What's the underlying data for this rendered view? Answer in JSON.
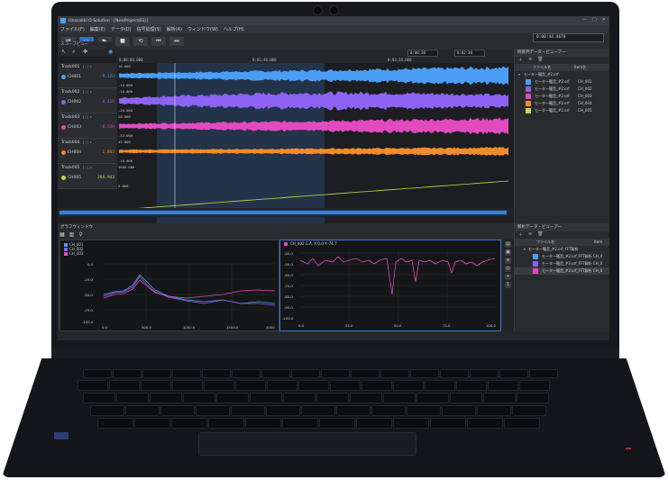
{
  "app": {
    "title": "Onosokki O-Solution - [NewProject(61)]",
    "menu": [
      "ファイル(F)",
      "編集(E)",
      "データ(D)",
      "信号処理(S)",
      "解析(A)",
      "ウィンドウ(W)",
      "ヘルプ(H)"
    ],
    "time_display": "0:00:44.4678"
  },
  "scope_panel": {
    "tab_label": "スコープビュー",
    "transport_start": "0:00:30",
    "transport_end": "0:02:30",
    "ruler_labels": [
      "0:00:00.000",
      "0:01:40.000",
      "0:03:20.000"
    ],
    "tracks": [
      {
        "name": "Track001",
        "channel": "CH001",
        "value": "-9.323",
        "color": "#4a9ef5",
        "scale_top": "16.000",
        "scale_bottom": "-16.000"
      },
      {
        "name": "Track002",
        "channel": "CH002",
        "value": "8.425",
        "color": "#8c63f2",
        "scale_top": "-18.000",
        "scale_bottom": "-20.000"
      },
      {
        "name": "Track003",
        "channel": "CH003",
        "value": "-8.539",
        "color": "#e24bc0",
        "scale_top": "20.000",
        "scale_bottom": "-32.000"
      },
      {
        "name": "Track004",
        "channel": "CH004",
        "value": "1.883",
        "color": "#f08c2a",
        "scale_top": "32.000",
        "scale_bottom": "-16.000"
      },
      {
        "name": "Track005",
        "channel": "CH005",
        "value": "284.943",
        "color": "#c7d94a",
        "scale_top": "3600.000",
        "scale_bottom": "0.000"
      }
    ]
  },
  "data_viewer": {
    "title": "時系列データ・ビューアー",
    "columns": [
      "ファイル名",
      "Item名"
    ],
    "group": "モーター騒音_#2.orf",
    "items": [
      {
        "file": "モーター騒音_#2.orf",
        "item": "CH_001",
        "color": "#4a9ef5"
      },
      {
        "file": "モーター騒音_#2.orf",
        "item": "CH_002",
        "color": "#8c63f2"
      },
      {
        "file": "モーター騒音_#2.orf",
        "item": "CH_003",
        "color": "#e24bc0"
      },
      {
        "file": "モーター騒音_#2.orf",
        "item": "CH_004",
        "color": "#f08c2a"
      },
      {
        "file": "モーター騒音_#2.orf",
        "item": "CH_005",
        "color": "#c7d94a"
      }
    ]
  },
  "graph_panel": {
    "tab_label": "グラフウィンドウ",
    "left_legend": [
      {
        "label": "CH_001",
        "color": "#4a9ef5"
      },
      {
        "label": "CH_002",
        "color": "#8c63f2"
      },
      {
        "label": "CH_003",
        "color": "#e24bc0"
      }
    ],
    "left_y_ticks": [
      "0.0",
      "-25.0",
      "-50.0",
      "-75.0",
      "-100.0"
    ],
    "left_x_ticks": [
      "0.0",
      "500.0",
      "1000.0",
      "1500.0",
      "2000"
    ],
    "right_header": "CH_002  G.A. X:0.0 Y:-74.7",
    "right_y_ticks": [
      "-40.0",
      "-50.0",
      "-60.0",
      "-70.0",
      "-80.0",
      "-90.0",
      "-100.0"
    ],
    "right_x_ticks": [
      "0.0",
      "25.0",
      "50.0",
      "75.0",
      "100.0"
    ]
  },
  "analysis_viewer": {
    "title": "解析データ・ビューアー",
    "columns": [
      "ファイル名",
      "Item"
    ],
    "group": "モーター騒音_#2.orf_FFT解析",
    "items": [
      {
        "file": "モーター騒音_#2.orf_FFT解析 CH_0",
        "color": "#4a9ef5"
      },
      {
        "file": "モーター騒音_#2.orf_FFT解析 CH_0",
        "color": "#8c63f2"
      },
      {
        "file": "モーター騒音_#2.orf_FFT解析 CH_0",
        "color": "#e24bc0"
      }
    ]
  }
}
